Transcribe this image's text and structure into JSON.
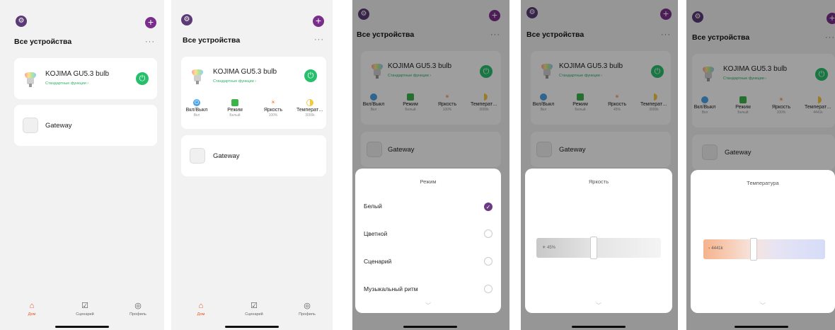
{
  "header": {
    "title": "Все устройства",
    "more": "···",
    "logo": "⚙",
    "plus": "+"
  },
  "device": {
    "name": "KOJIMA GU5.3 bulb",
    "sub": "Стандартные функции ›",
    "power_icon": "⏻"
  },
  "gateway": {
    "name": "Gateway"
  },
  "controls": {
    "power": {
      "label": "Вкл/Выкл",
      "value": "Вкл"
    },
    "mode": {
      "label": "Режим",
      "value": "Белый"
    },
    "brightness": {
      "label": "Яркость",
      "value": "100%",
      "value_b": "45%"
    },
    "temp": {
      "label": "Температ…",
      "value": "3000k",
      "value_c": "4441k"
    }
  },
  "tabs": {
    "home": "Дом",
    "scene": "Сценарий",
    "profile": "Профиль"
  },
  "mode_sheet": {
    "title": "Режим",
    "options": [
      "Белый",
      "Цветной",
      "Сценарий",
      "Музыкальный ритм"
    ],
    "check": "✓"
  },
  "brightness_sheet": {
    "title": "Яркость",
    "value": "45%"
  },
  "temp_sheet": {
    "title": "Температура",
    "value": "4441k"
  },
  "colors": {
    "accent": "#6b3b84",
    "green": "#26c06c",
    "home_tab": "#e8541e"
  }
}
